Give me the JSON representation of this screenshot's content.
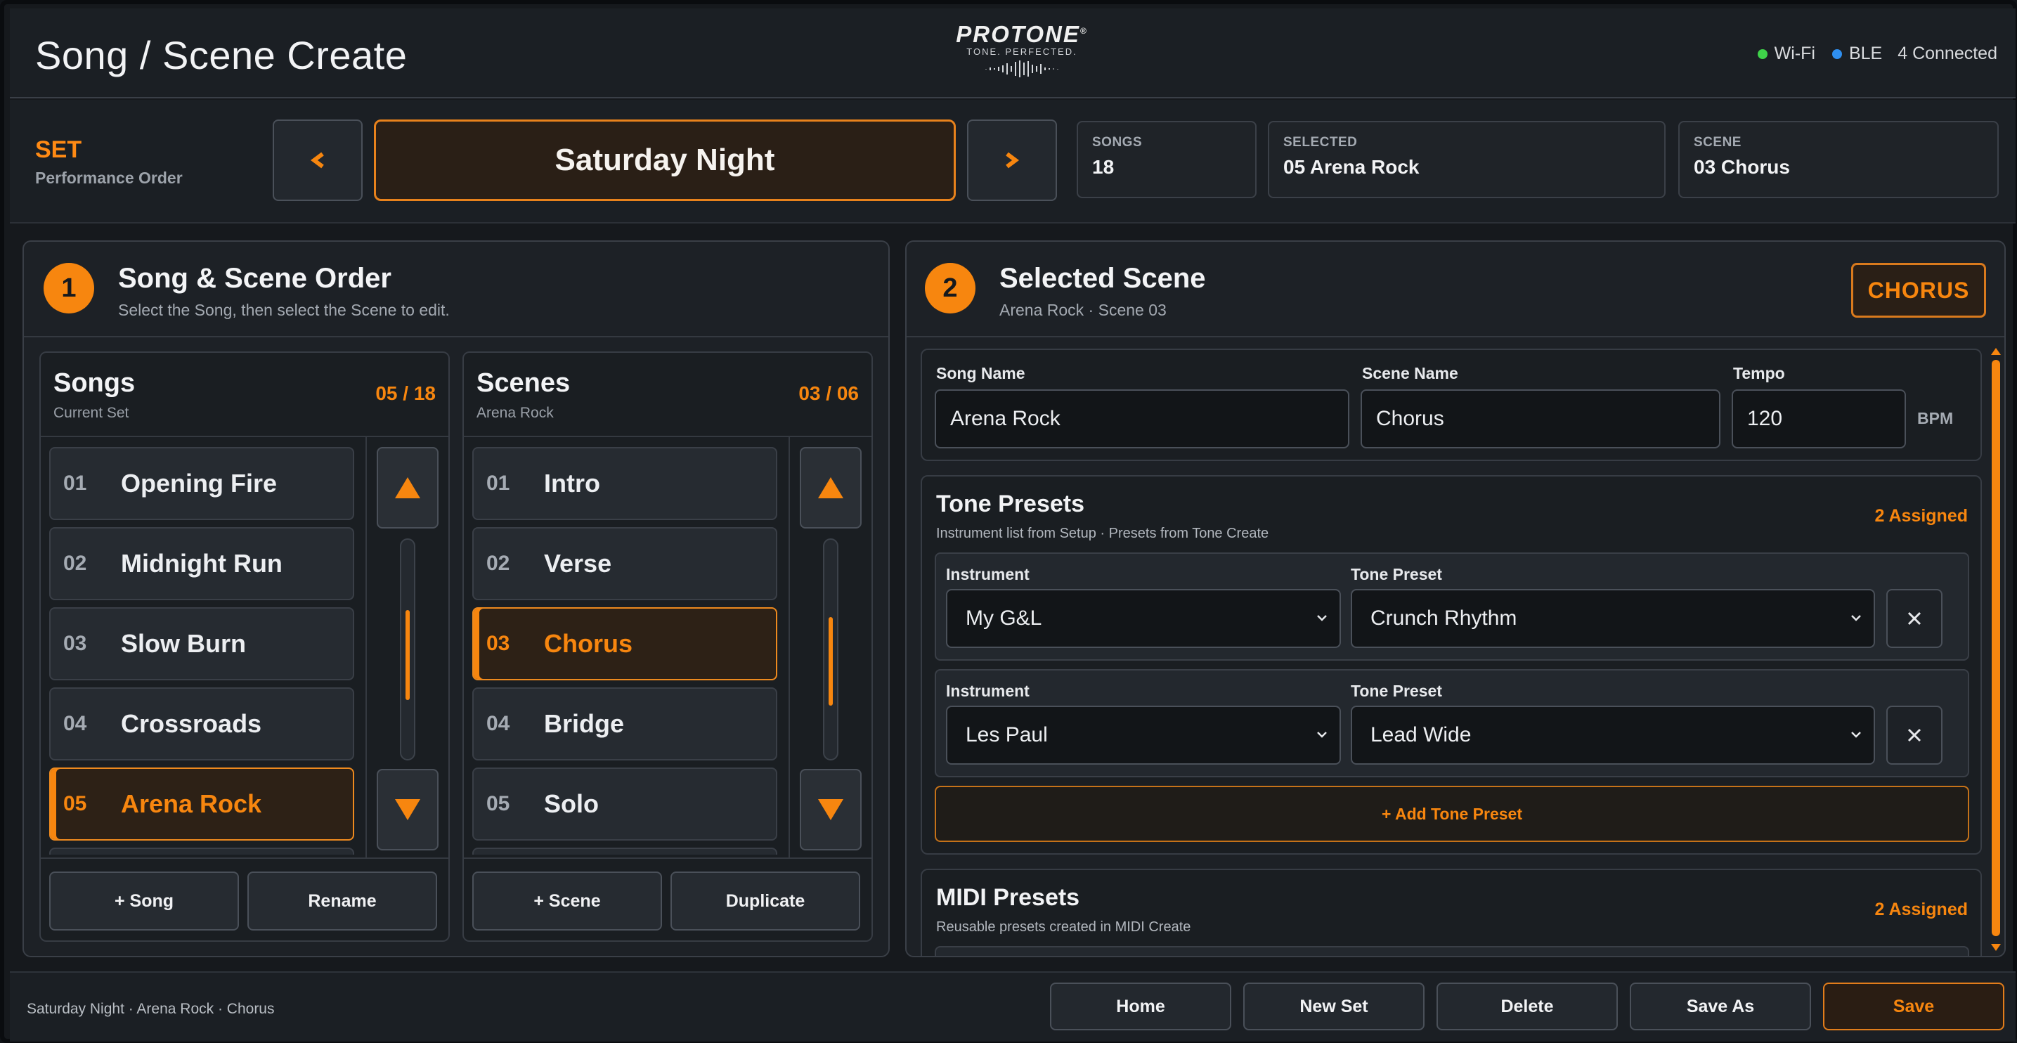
{
  "header": {
    "title": "Song / Scene Create",
    "logo_name": "PROTONE",
    "logo_mark": "®",
    "logo_tagline": "TONE. PERFECTED.",
    "wifi_label": "Wi-Fi",
    "ble_label": "BLE",
    "connected_label": "4 Connected",
    "wifi_color": "#3fd24a",
    "ble_color": "#2f8ff0"
  },
  "setbar": {
    "label": "SET",
    "sublabel": "Performance Order",
    "set_name": "Saturday Night",
    "prev_icon": "chevron-left-icon",
    "next_icon": "chevron-right-icon",
    "stats": [
      {
        "label": "SONGS",
        "value": "18"
      },
      {
        "label": "SELECTED",
        "value": "05 Arena Rock"
      },
      {
        "label": "SCENE",
        "value": "03 Chorus"
      }
    ]
  },
  "left_panel": {
    "step": "1",
    "title": "Song & Scene Order",
    "subtitle": "Select the Song, then select the Scene to edit.",
    "songs": {
      "title": "Songs",
      "subtitle": "Current Set",
      "count": "05 / 18",
      "items": [
        {
          "num": "01",
          "name": "Opening Fire"
        },
        {
          "num": "02",
          "name": "Midnight Run"
        },
        {
          "num": "03",
          "name": "Slow Burn"
        },
        {
          "num": "04",
          "name": "Crossroads"
        },
        {
          "num": "05",
          "name": "Arena Rock"
        }
      ],
      "selected_index": 4,
      "add_label": "+ Song",
      "rename_label": "Rename"
    },
    "scenes": {
      "title": "Scenes",
      "subtitle": "Arena Rock",
      "count": "03 / 06",
      "items": [
        {
          "num": "01",
          "name": "Intro"
        },
        {
          "num": "02",
          "name": "Verse"
        },
        {
          "num": "03",
          "name": "Chorus"
        },
        {
          "num": "04",
          "name": "Bridge"
        },
        {
          "num": "05",
          "name": "Solo"
        }
      ],
      "selected_index": 2,
      "add_label": "+ Scene",
      "duplicate_label": "Duplicate"
    }
  },
  "right_panel": {
    "step": "2",
    "title": "Selected Scene",
    "subtitle": "Arena Rock · Scene 03",
    "tag": "CHORUS",
    "fields": {
      "song_name_label": "Song Name",
      "song_name_value": "Arena Rock",
      "scene_name_label": "Scene Name",
      "scene_name_value": "Chorus",
      "tempo_label": "Tempo",
      "tempo_value": "120",
      "tempo_unit": "BPM"
    },
    "tone_presets": {
      "title": "Tone Presets",
      "subtitle": "Instrument list from Setup · Presets from Tone Create",
      "assigned": "2 Assigned",
      "rows": [
        {
          "instrument_label": "Instrument",
          "instrument": "My G&L",
          "preset_label": "Tone Preset",
          "preset": "Crunch Rhythm"
        },
        {
          "instrument_label": "Instrument",
          "instrument": "Les Paul",
          "preset_label": "Tone Preset",
          "preset": "Lead Wide"
        }
      ],
      "add_label": "+ Add Tone Preset"
    },
    "midi_presets": {
      "title": "MIDI Presets",
      "subtitle": "Reusable presets created in MIDI Create",
      "assigned": "2 Assigned"
    }
  },
  "footer": {
    "breadcrumb": "Saturday Night · Arena Rock · Chorus",
    "buttons": {
      "home": "Home",
      "new_set": "New Set",
      "delete": "Delete",
      "save_as": "Save As",
      "save": "Save"
    }
  },
  "colors": {
    "accent": "#f7860f",
    "background": "#16191d",
    "panel": "#1d2126"
  }
}
